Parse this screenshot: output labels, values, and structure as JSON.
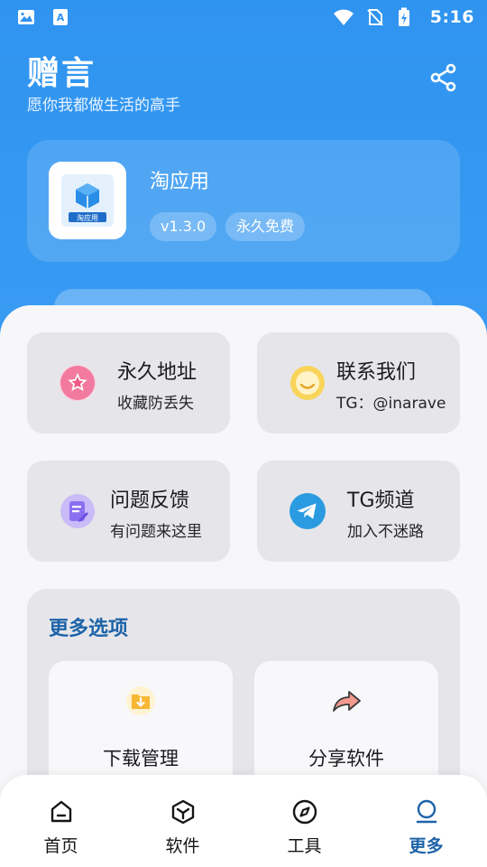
{
  "status_bar": {
    "time": "5:16",
    "icons": [
      "image-icon",
      "text-app-icon",
      "wifi-icon",
      "no-sim-icon",
      "battery-charging-icon"
    ]
  },
  "header": {
    "title": "赠言",
    "subtitle": "愿你我都做生活的高手",
    "share_icon": "share-icon"
  },
  "app_card": {
    "name": "淘应用",
    "logo_text": "淘应用",
    "version": "v1.3.0",
    "badge": "永久免费"
  },
  "tiles": [
    {
      "title": "永久地址",
      "subtitle": "收藏防丢失",
      "icon": "star-icon",
      "color": "#f0628c"
    },
    {
      "title": "联系我们",
      "subtitle": "TG：@inarave",
      "icon": "smile-icon",
      "color": "#f6c94a"
    },
    {
      "title": "问题反馈",
      "subtitle": "有问题来这里",
      "icon": "feedback-icon",
      "color": "#8a6cf0"
    },
    {
      "title": "TG频道",
      "subtitle": "加入不迷路",
      "icon": "telegram-icon",
      "color": "#2a9be0"
    }
  ],
  "more": {
    "title": "更多选项",
    "options": [
      {
        "label": "下载管理",
        "icon": "download-folder-icon"
      },
      {
        "label": "分享软件",
        "icon": "share-arrow-icon"
      }
    ]
  },
  "nav": {
    "items": [
      {
        "label": "首页",
        "icon": "home-icon"
      },
      {
        "label": "软件",
        "icon": "cube-icon"
      },
      {
        "label": "工具",
        "icon": "compass-icon"
      },
      {
        "label": "更多",
        "icon": "user-icon"
      }
    ],
    "active": "更多"
  },
  "colors": {
    "primary": "#2f92ee",
    "accent": "#1d63a8",
    "tile_bg": "#e6e6ea",
    "sheet_bg": "#f7f7fa"
  }
}
